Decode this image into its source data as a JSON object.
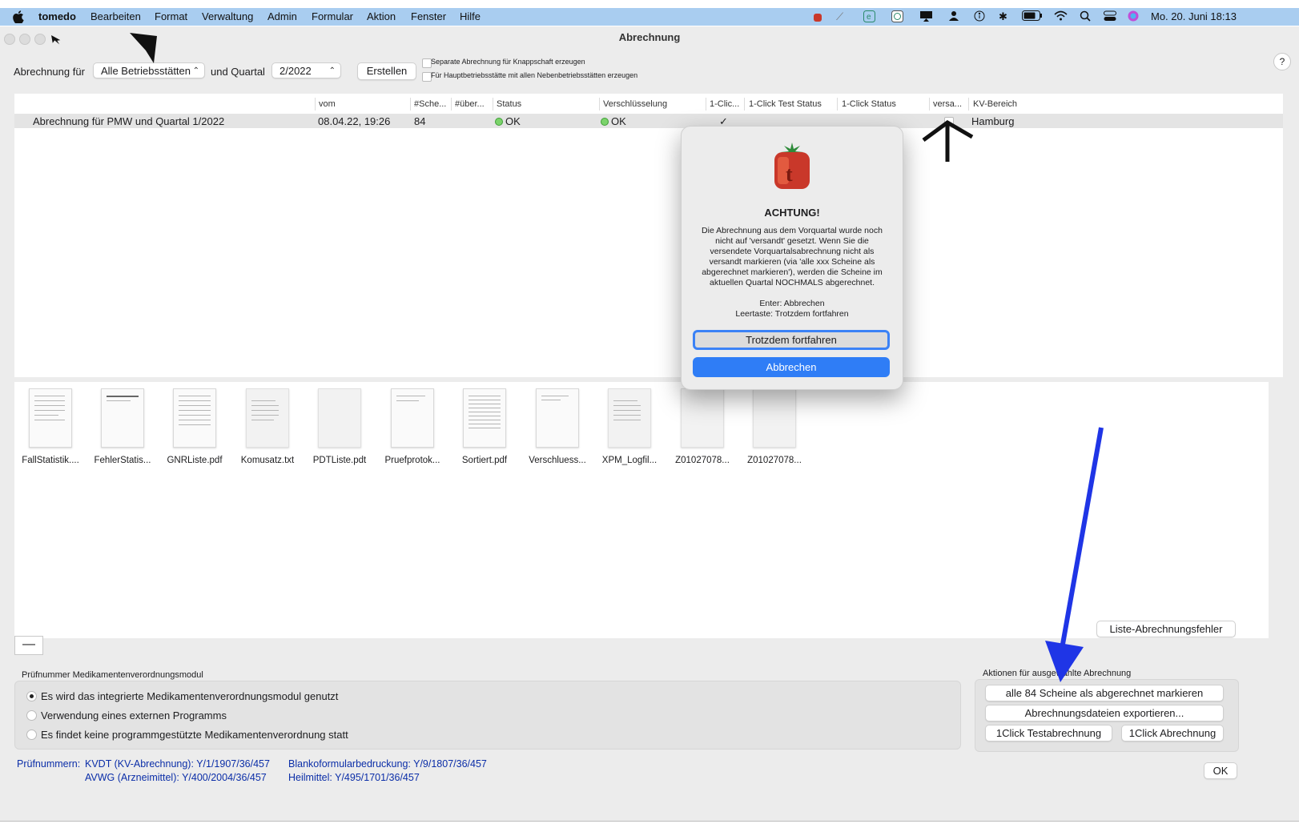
{
  "menubar": {
    "app_name": "tomedo",
    "items": [
      "Bearbeiten",
      "Format",
      "Verwaltung",
      "Admin",
      "Formular",
      "Aktion",
      "Fenster",
      "Hilfe"
    ],
    "clock": "Mo. 20. Juni 18:13"
  },
  "window": {
    "title": "Abrechnung",
    "help_label": "?"
  },
  "toolbar": {
    "label_for": "Abrechnung für",
    "betrieb_value": "Alle Betriebsstätten",
    "label_quarter": "und Quartal",
    "quarter_value": "2/2022",
    "create_label": "Erstellen",
    "option1": "Separate Abrechnung für Knappschaft erzeugen",
    "option2": "Für Hauptbetriebsstätte mit allen Nebenbetriebsstätten erzeugen"
  },
  "table": {
    "headers": [
      "vom",
      "#Sche...",
      "#über...",
      "Status",
      "Verschlüsselung",
      "1-Clic...",
      "1-Click Test Status",
      "1-Click Status",
      "versa...",
      "KV-Bereich"
    ],
    "rows": [
      {
        "name": "Abrechnung für PMW und Quartal 1/2022",
        "vom": "08.04.22, 19:26",
        "scheine": "84",
        "status": "OK",
        "verschluesselung": "OK",
        "one_click": "✓",
        "kv_bereich": "Hamburg"
      }
    ]
  },
  "files": [
    "FallStatistik....",
    "FehlerStatis...",
    "GNRListe.pdf",
    "Komusatz.txt",
    "PDTListe.pdt",
    "Pruefprotok...",
    "Sortiert.pdf",
    "Verschluess...",
    "XPM_Logfil...",
    "Z01027078...",
    "Z01027078..."
  ],
  "remove_label": "—",
  "error_list_button": "Liste-Abrechnungsfehler",
  "medication": {
    "group_label": "Prüfnummer Medikamentenverordnungsmodul",
    "options": [
      "Es wird das integrierte Medikamentenverordnungsmodul genutzt",
      "Verwendung eines externen Programms",
      "Es findet keine programmgestützte Medikamentenverordnung statt"
    ],
    "selected_index": 0
  },
  "actions": {
    "group_label": "Aktionen für ausgewählte Abrechnung",
    "mark_button": "alle 84 Scheine als abgerechnet markieren",
    "export_button": "Abrechnungsdateien exportieren...",
    "test_button": "1Click Testabrechnung",
    "click_button": "1Click Abrechnung"
  },
  "pruefnummern": {
    "label": "Prüfnummern:",
    "kvdt": "KVDT (KV-Abrechnung): Y/1/1907/36/457",
    "avwg": "AVWG (Arzneimittel): Y/400/2004/36/457",
    "blanko": "Blankoformularbedruckung: Y/9/1807/36/457",
    "heilmittel": "Heilmittel: Y/495/1701/36/457"
  },
  "ok_label": "OK",
  "dialog": {
    "title": "ACHTUNG!",
    "message": "Die Abrechnung aus dem Vorquartal wurde noch nicht auf 'versandt' gesetzt. Wenn Sie die versendete Vorquartalsabrechnung nicht als versandt markieren (via 'alle xxx Scheine als abgerechnet markieren'), werden die Scheine im aktuellen Quartal NOCHMALS abgerechnet.",
    "hint_enter": "Enter: Abbrechen",
    "hint_space": "Leertaste: Trotzdem fortfahren",
    "continue_button": "Trotzdem fortfahren",
    "cancel_button": "Abbrechen"
  },
  "colors": {
    "menubar_bg": "#a9cdf0",
    "accent": "#2f7df6",
    "annotation_arrow": "#1f35e6",
    "link_text": "#0b2ea8"
  }
}
